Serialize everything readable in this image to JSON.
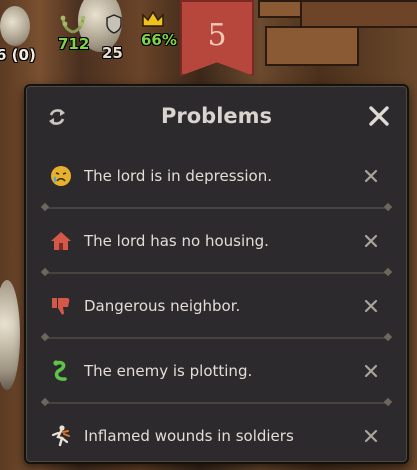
{
  "hud": {
    "population_text": "6 (0)",
    "loyalty_value": "712",
    "shield_value": "25",
    "approval_value": "66%",
    "turn_banner": "5"
  },
  "panel": {
    "title": "Problems",
    "icons": {
      "refresh": "refresh-icon",
      "close": "close-icon"
    }
  },
  "problems": [
    {
      "label": "The lord is in depression.",
      "icon": "crying-face-icon",
      "color": "#e7b12d"
    },
    {
      "label": "The lord has no housing.",
      "icon": "house-icon",
      "color": "#d3584a"
    },
    {
      "label": "Dangerous neighbor.",
      "icon": "thumbs-down-icon",
      "color": "#d3584a"
    },
    {
      "label": "The enemy is plotting.",
      "icon": "snake-icon",
      "color": "#5fc24a"
    },
    {
      "label": "Inflamed wounds in soldiers",
      "icon": "wounded-soldier-icon",
      "color": "#e0772d"
    }
  ]
}
